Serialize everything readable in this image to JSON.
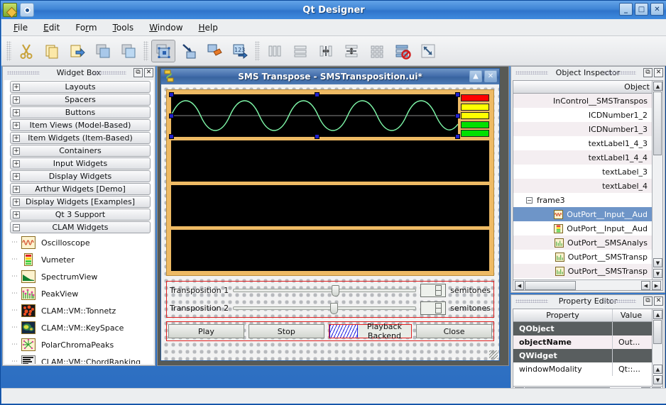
{
  "window": {
    "title": "Qt Designer",
    "app_icon": "designer-icon",
    "win_icon": "window-icon",
    "minimize": "_",
    "maximize": "□",
    "close": "✕"
  },
  "menubar": {
    "items": [
      {
        "label": "File",
        "mnemonic": "F"
      },
      {
        "label": "Edit",
        "mnemonic": "E"
      },
      {
        "label": "Form",
        "mnemonic": "r"
      },
      {
        "label": "Tools",
        "mnemonic": "T"
      },
      {
        "label": "Window",
        "mnemonic": "W"
      },
      {
        "label": "Help",
        "mnemonic": "H"
      }
    ]
  },
  "toolbar": {
    "buttons": [
      {
        "name": "cut-icon",
        "tip": "Cut"
      },
      {
        "name": "copy-icon",
        "tip": "Copy"
      },
      {
        "name": "paste-icon",
        "tip": "Paste"
      },
      {
        "name": "duplicate-icon",
        "tip": "Duplicate"
      },
      {
        "name": "new-form-icon",
        "tip": "New Form"
      },
      {
        "name": "edit-widgets-icon",
        "tip": "Edit Widgets",
        "active": true
      },
      {
        "name": "edit-signals-slots-icon",
        "tip": "Edit Signals/Slots"
      },
      {
        "name": "edit-buddies-icon",
        "tip": "Edit Buddies"
      },
      {
        "name": "edit-tab-order-icon",
        "tip": "Edit Tab Order"
      },
      {
        "name": "layout-horizontally-icon",
        "tip": "Lay Out Horizontally"
      },
      {
        "name": "layout-vertically-icon",
        "tip": "Lay Out Vertically"
      },
      {
        "name": "layout-splitter-h-icon",
        "tip": "Lay Out Horizontally in Splitter"
      },
      {
        "name": "layout-splitter-v-icon",
        "tip": "Lay Out Vertically in Splitter"
      },
      {
        "name": "layout-grid-icon",
        "tip": "Lay Out in a Grid"
      },
      {
        "name": "break-layout-icon",
        "tip": "Break Layout"
      },
      {
        "name": "adjust-size-icon",
        "tip": "Adjust Size"
      }
    ]
  },
  "widget_box": {
    "title": "Widget Box",
    "float_btn": "⧉",
    "close_btn": "✕",
    "categories": [
      {
        "label": "Layouts",
        "expanded": false
      },
      {
        "label": "Spacers",
        "expanded": false
      },
      {
        "label": "Buttons",
        "expanded": false
      },
      {
        "label": "Item Views (Model-Based)",
        "expanded": false
      },
      {
        "label": "Item Widgets (Item-Based)",
        "expanded": false
      },
      {
        "label": "Containers",
        "expanded": false
      },
      {
        "label": "Input Widgets",
        "expanded": false
      },
      {
        "label": "Display Widgets",
        "expanded": false
      },
      {
        "label": "Arthur Widgets [Demo]",
        "expanded": false
      },
      {
        "label": "Display Widgets [Examples]",
        "expanded": false
      },
      {
        "label": "Qt 3 Support",
        "expanded": false
      },
      {
        "label": "CLAM Widgets",
        "expanded": true
      }
    ],
    "items": [
      {
        "label": "Oscilloscope",
        "icon": "oscilloscope-icon"
      },
      {
        "label": "Vumeter",
        "icon": "vumeter-icon"
      },
      {
        "label": "SpectrumView",
        "icon": "spectrumview-icon"
      },
      {
        "label": "PeakView",
        "icon": "peakview-icon"
      },
      {
        "label": "CLAM::VM::Tonnetz",
        "icon": "tonnetz-icon"
      },
      {
        "label": "CLAM::VM::KeySpace",
        "icon": "keyspace-icon"
      },
      {
        "label": "PolarChromaPeaks",
        "icon": "polarchromapeaks-icon"
      },
      {
        "label": "CLAM::VM::ChordRanking",
        "icon": "chordranking-icon"
      }
    ]
  },
  "form_window": {
    "title": "SMS Transpose - SMSTransposition.ui*",
    "icon": "form-icon",
    "shade_btn": "▲",
    "close_btn": "✕",
    "panels": [
      {
        "name": "oscilloscope-panel",
        "selected": true,
        "has_vumeter": true
      },
      {
        "name": "spectrum-panel-1",
        "selected": false,
        "has_vumeter": false
      },
      {
        "name": "spectrum-panel-2",
        "selected": false,
        "has_vumeter": false
      },
      {
        "name": "spectrum-panel-3",
        "selected": false,
        "has_vumeter": false
      }
    ],
    "vumeter_bars": [
      "#ff0000",
      "#ffff00",
      "#ffff00",
      "#00e000",
      "#00e000"
    ],
    "waveform_color": "#7ef7a8",
    "sliders": [
      {
        "label": "Transposition 1",
        "value": "",
        "unit": "semitones",
        "position_pct": 54
      },
      {
        "label": "Transposition 2",
        "value": "",
        "unit": "semitones",
        "position_pct": 53
      }
    ],
    "buttons": [
      {
        "label": "Play",
        "name": "play-button"
      },
      {
        "label": "Stop",
        "name": "stop-button"
      },
      {
        "label": "Close",
        "name": "close-button"
      }
    ],
    "playback_backend": {
      "label": "Playback Backend",
      "name": "playback-backend-label"
    }
  },
  "object_inspector": {
    "title": "Object Inspector",
    "float_btn": "⧉",
    "close_btn": "✕",
    "header": "Object",
    "rows": [
      {
        "label": "InControl__SMSTranspos",
        "icon": null,
        "selected": false,
        "node": false
      },
      {
        "label": "ICDNumber1_2",
        "icon": null,
        "selected": false,
        "node": false
      },
      {
        "label": "ICDNumber1_3",
        "icon": null,
        "selected": false,
        "node": false
      },
      {
        "label": "textLabel1_4_3",
        "icon": null,
        "selected": false,
        "node": false
      },
      {
        "label": "textLabel1_4_4",
        "icon": null,
        "selected": false,
        "node": false
      },
      {
        "label": "textLabel_3",
        "icon": null,
        "selected": false,
        "node": false
      },
      {
        "label": "textLabel_4",
        "icon": null,
        "selected": false,
        "node": false
      },
      {
        "label": "frame3",
        "icon": null,
        "selected": false,
        "node": true
      },
      {
        "label": "OutPort__Input__Aud",
        "icon": "oscilloscope-icon",
        "selected": true,
        "node": false
      },
      {
        "label": "OutPort__Input__Aud",
        "icon": "vumeter-icon",
        "selected": false,
        "node": false
      },
      {
        "label": "OutPort__SMSAnalys",
        "icon": "peakview-icon",
        "selected": false,
        "node": false
      },
      {
        "label": "OutPort__SMSTransp",
        "icon": "peakview-icon",
        "selected": false,
        "node": false
      },
      {
        "label": "OutPort__SMSTransp",
        "icon": "peakview-icon",
        "selected": false,
        "node": false
      }
    ]
  },
  "property_editor": {
    "title": "Property Editor",
    "float_btn": "⧉",
    "close_btn": "✕",
    "columns": [
      "Property",
      "Value"
    ],
    "rows": [
      {
        "property": "QObject",
        "value": "",
        "type": "group"
      },
      {
        "property": "objectName",
        "value": "Out...",
        "type": "prop"
      },
      {
        "property": "QWidget",
        "value": "",
        "type": "group"
      },
      {
        "property": "windowModality",
        "value": "Qt::...",
        "type": "prop"
      }
    ]
  },
  "scroll": {
    "up": "▲",
    "down": "▼",
    "left": "◀",
    "right": "▶"
  }
}
